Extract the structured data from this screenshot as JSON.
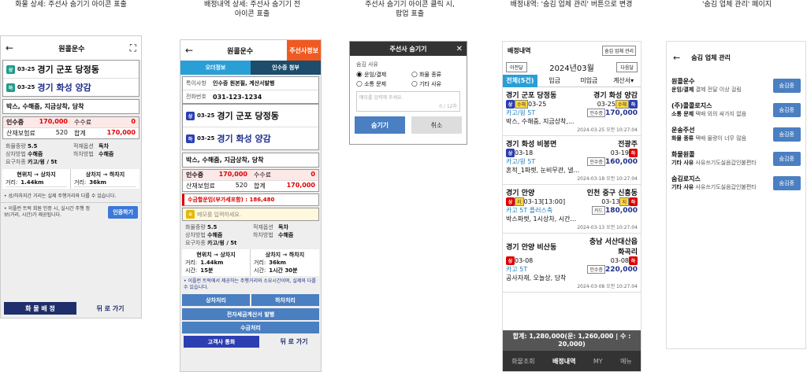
{
  "captions": [
    "화물 상세: 주선사 숨기기 아이콘 표출",
    "배정내역 상세: 주선사 숨기기 전\n아이콘 표출",
    "주선사 숨기기 아이콘 클릭 시,\n팝업 표출",
    "배정내역: '숨김 업체 관리' 버튼으로 변경",
    "'숨김 업체 관리' 페이지"
  ],
  "s1": {
    "title": "원콜운수",
    "date1": "03-25",
    "from": "경기 군포 당정동",
    "date2": "03-25",
    "to": "경기 화성 양감",
    "cargo": "박스, 수해줌, 지금상착, 당착",
    "fee_label": "인수증",
    "fee": "170,000",
    "fee2_label": "수수료",
    "fee2": "0",
    "ins_label": "산재보험료",
    "ins": "520",
    "total_label": "합계",
    "total": "170,000",
    "weight_l": "화물중량",
    "weight": "5.5",
    "opt_l": "적재옵션",
    "opt": "독차",
    "load_l": "상차방법",
    "load": "수해줌",
    "unload_l": "하차방법",
    "unload": "수해줌",
    "car_l": "요구차종",
    "car": "카고/윙 / 5t",
    "r1": "현위치 → 상차지",
    "r2": "상차지 → 하차지",
    "d1_l": "거리:",
    "d1": "1.44km",
    "d2_l": "거리:",
    "d2": "36km",
    "note": "• 상/하차지간 거리는 실제 주행거리와 다를 수 있습니다.",
    "note2": "• 이플런 트럭 회원 인증 시, 실시간 주행 정보(거리, 시간)가 제공됩니다.",
    "auth": "인증하기",
    "btn1": "화 물 배 정",
    "btn2": "뒤 로 가기"
  },
  "s2": {
    "title": "원콜운수",
    "badge": "주선사정보",
    "tab1": "오더정보",
    "tab2": "인수증 첨부",
    "sp_l": "특이사항",
    "sp": "인수증 원본필, 계산서발행",
    "tel_l": "전화번호",
    "tel": "031-123-1234",
    "date1": "03-25",
    "from": "경기 군포 당정동",
    "date2": "03-25",
    "to": "경기 화성 양감",
    "cargo": "박스, 수해줌, 지금상착, 당착",
    "fee_label": "인수증",
    "fee": "170,000",
    "fee2_label": "수수료",
    "fee2": "0",
    "ins_label": "산재보험료",
    "ins": "520",
    "total_label": "합계",
    "total": "170,000",
    "recv": "수금할운임(부가세포함) : 186,480",
    "memo_ph": "메모를 입력하세요.",
    "weight_l": "화물중량",
    "weight": "5.5",
    "opt_l": "적재옵션",
    "opt": "독차",
    "load_l": "상차방법",
    "load": "수해줌",
    "unload_l": "하차방법",
    "unload": "수해줌",
    "car_l": "요구차종",
    "car": "카고/윙 / 5t",
    "r1": "현위치 → 상차지",
    "r2": "상차지 → 하차지",
    "d1_l": "거리:",
    "d1": "1.44km",
    "d2_l": "거리:",
    "d2": "36km",
    "t1_l": "시간:",
    "t1": "15분",
    "t2_l": "시간:",
    "t2": "1시간 30분",
    "note": "• 이플런 트럭에서 제공하는 주행거리와 소요시간이며, 실제와 다를 수 있습니다.",
    "b1": "상차처리",
    "b2": "하차처리",
    "b3": "전자세금계산서 발행",
    "b4": "수금처리",
    "b5": "고객사 통화",
    "b6": "뒤 로 가기"
  },
  "s3": {
    "title": "주선사 숨기기",
    "reason": "숨김 사유",
    "o1": "운임/결제",
    "o2": "화물 종류",
    "o3": "소통 문제",
    "o4": "기타 사유",
    "ph": "메모를 입력해 주세요.",
    "count": "0 / 12자",
    "ok": "숨기기",
    "cancel": "취소"
  },
  "s4": {
    "title": "배정내역",
    "hide_btn": "숨김 업체 관리",
    "prev": "이전달",
    "month": "2024년03월",
    "next": "다음달",
    "tabs": [
      "전체(5건)",
      "입금",
      "미입금",
      "계산서▾"
    ],
    "cards": [
      {
        "from": "경기 군포 당정동",
        "to": "경기 화성 양감",
        "d1": "03-25",
        "d2": "03-25",
        "car": "카고/윙 5T",
        "price": "170,000",
        "plabel": "인수증",
        "desc": "박스, 수해줌, 지금상착,...",
        "time": "2024-03-25 오전 10:27:04"
      },
      {
        "from": "경기 화성 비봉면",
        "to": "전광주",
        "d1": "03-18",
        "d2": "03-19",
        "car": "카고/윙 5T",
        "price": "160,000",
        "plabel": "인수증",
        "desc": "혼적_1파렛, 눈비무관, 낼...",
        "time": "2024-03-18 오전 10:27:04"
      },
      {
        "from": "경기 안양",
        "to": "인천 중구 신흥동",
        "d1": "03-13[13:00]",
        "d2": "03-13",
        "car": "카고 5T 플러스축",
        "price": "180,000",
        "plabel": "카드",
        "desc": "박스파렛, 1시상차, 시간...",
        "time": "2024-03-13 오전 10:27:04"
      },
      {
        "from": "경기 안양 비산동",
        "to": "충남 서산대산읍 화곡리",
        "d1": "03-08",
        "d2": "03-08",
        "car": "카고 5T",
        "price": "220,000",
        "plabel": "인수증",
        "desc": "공사자재, 오늘상, 당착",
        "time": "2024-03-08 오전 10:27:04"
      }
    ],
    "summary": "합계: 1,280,000(운: 1,260,000 | 수 : 20,000)",
    "nav": [
      "화물조회",
      "배정내역",
      "MY",
      "메뉴"
    ]
  },
  "s5": {
    "title": "숨김 업체 관리",
    "btn": "숨김중",
    "items": [
      {
        "name": "원콜운수",
        "reason": "운임/결제",
        "memo": "결제 전달 이상 걸림"
      },
      {
        "name": "(주)콜콜로지스",
        "reason": "소통 문제",
        "memo": "택배 외의 싸가지 없음"
      },
      {
        "name": "운송주선",
        "reason": "화물 종류",
        "memo": "택배 물량이 너무 많음"
      },
      {
        "name": "화물원콜",
        "reason": "기타 사유",
        "memo": "사유쓰기도싫음갑인불편타"
      },
      {
        "name": "숨김로지스",
        "reason": "기타 사유",
        "memo": "사유쓰기도싫음갑인불편타"
      }
    ]
  },
  "colors": {
    "blue": "#4a7fc1",
    "dark": "#1f2f6b",
    "red": "#d00",
    "orange": "#f05a22",
    "teal": "#1e7fb8"
  }
}
